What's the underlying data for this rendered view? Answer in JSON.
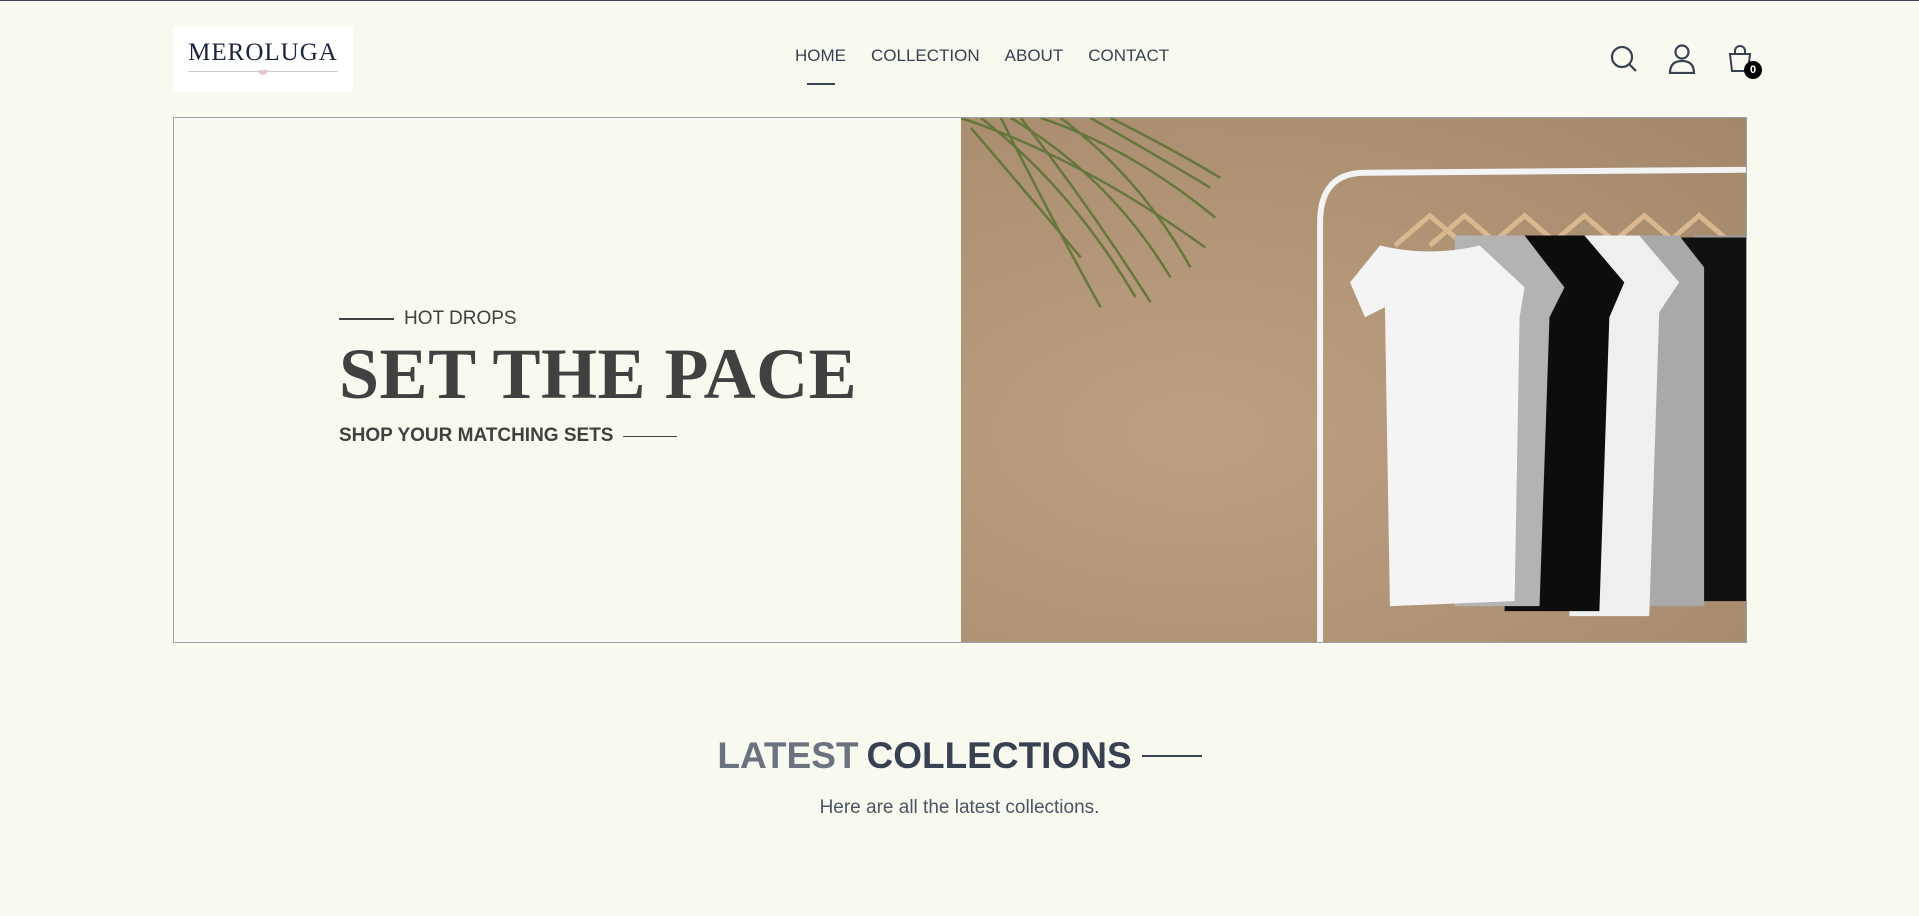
{
  "brand": {
    "logo_text": "MEROLUGA"
  },
  "nav": {
    "items": [
      {
        "label": "HOME",
        "active": true
      },
      {
        "label": "COLLECTION",
        "active": false
      },
      {
        "label": "ABOUT",
        "active": false
      },
      {
        "label": "CONTACT",
        "active": false
      }
    ]
  },
  "header_icons": {
    "search": "search-icon",
    "profile": "user-icon",
    "cart": "shopping-bag-icon",
    "cart_count": "0"
  },
  "hero": {
    "eyebrow": "HOT DROPS",
    "headline": "SET THE PACE",
    "cta": "SHOP YOUR MATCHING SETS",
    "image_description": "T-shirts on a clothing rack"
  },
  "latest": {
    "title_light": "LATEST",
    "title_bold": "COLLECTIONS",
    "subtitle": "Here are all the latest collections."
  },
  "colors": {
    "page_bg": "#f8f9ef",
    "text": "#374151",
    "accent": "#000000"
  }
}
